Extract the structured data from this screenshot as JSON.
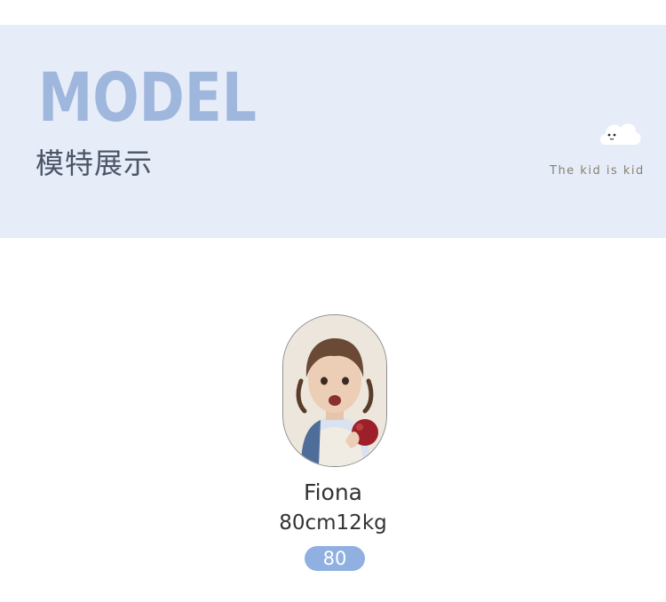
{
  "header": {
    "title": "MODEL",
    "subtitle": "模特展示",
    "tagline": "The kid is kid"
  },
  "model": {
    "name": "Fiona",
    "stats": "80cm12kg",
    "size_badge": "80"
  },
  "colors": {
    "banner_bg": "#e6edf9",
    "title_blue": "#9fb6dd",
    "badge_blue": "#8fb0e0",
    "text_dark": "#333333"
  },
  "icons": {
    "mascot": "cloud-icon"
  }
}
